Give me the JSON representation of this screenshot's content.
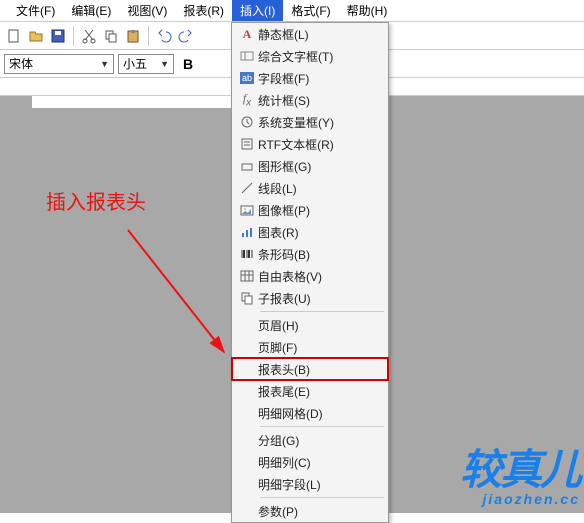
{
  "menubar": {
    "items": [
      {
        "label": "文件(F)"
      },
      {
        "label": "编辑(E)"
      },
      {
        "label": "视图(V)"
      },
      {
        "label": "报表(R)"
      },
      {
        "label": "插入(I)",
        "active": true
      },
      {
        "label": "格式(F)"
      },
      {
        "label": "帮助(H)"
      }
    ]
  },
  "font_combo": {
    "value": "宋体"
  },
  "size_combo": {
    "value": "小五"
  },
  "bold_label": "B",
  "annotation_text": "插入报表头",
  "dropdown": {
    "groups": [
      [
        {
          "icon": "A",
          "label": "静态框(L)"
        },
        {
          "icon": "field",
          "label": "综合文字框(T)"
        },
        {
          "icon": "ab",
          "label": "字段框(F)"
        },
        {
          "icon": "fx",
          "label": "统计框(S)"
        },
        {
          "icon": "clock",
          "label": "系统变量框(Y)"
        },
        {
          "icon": "rtf",
          "label": "RTF文本框(R)"
        },
        {
          "icon": "shape",
          "label": "图形框(G)"
        },
        {
          "icon": "line",
          "label": "线段(L)"
        },
        {
          "icon": "image",
          "label": "图像框(P)"
        },
        {
          "icon": "chart",
          "label": "图表(R)"
        },
        {
          "icon": "barcode",
          "label": "条形码(B)"
        },
        {
          "icon": "table",
          "label": "自由表格(V)"
        },
        {
          "icon": "subreport",
          "label": "子报表(U)"
        }
      ],
      [
        {
          "label": "页眉(H)"
        },
        {
          "label": "页脚(F)"
        },
        {
          "label": "报表头(B)",
          "highlight": true
        },
        {
          "label": "报表尾(E)"
        },
        {
          "label": "明细网格(D)"
        }
      ],
      [
        {
          "label": "分组(G)"
        },
        {
          "label": "明细列(C)"
        },
        {
          "label": "明细字段(L)"
        }
      ],
      [
        {
          "label": "参数(P)"
        }
      ]
    ]
  },
  "watermark": {
    "main": "较真儿",
    "sub": "jiaozhen.cc"
  }
}
